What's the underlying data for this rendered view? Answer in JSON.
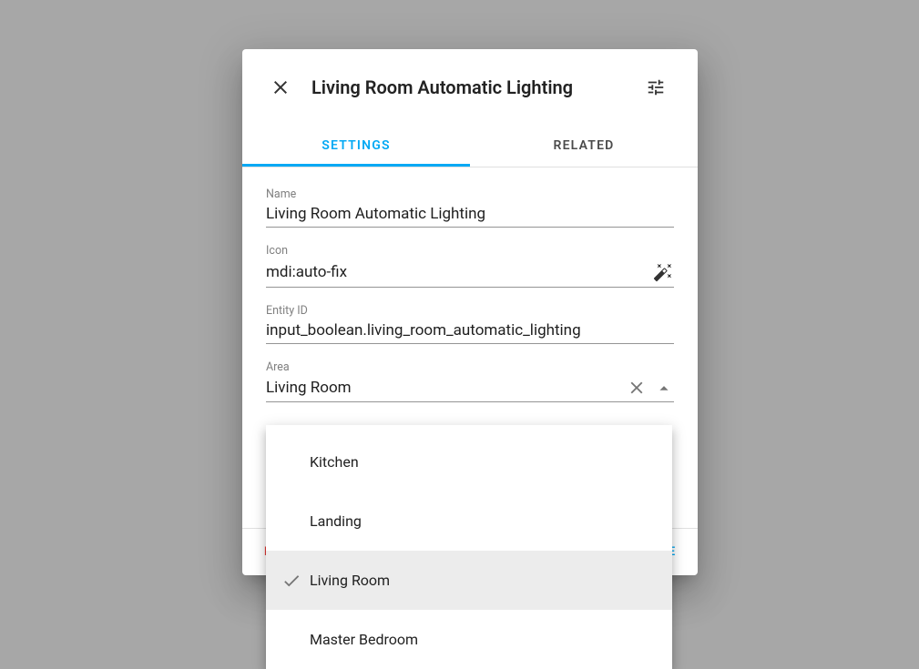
{
  "dialog": {
    "title": "Living Room Automatic Lighting",
    "tabs": {
      "settings": "SETTINGS",
      "related": "RELATED"
    },
    "fields": {
      "name": {
        "label": "Name",
        "value": "Living Room Automatic Lighting"
      },
      "icon": {
        "label": "Icon",
        "value": "mdi:auto-fix"
      },
      "entity_id": {
        "label": "Entity ID",
        "value": "input_boolean.living_room_automatic_lighting"
      },
      "area": {
        "label": "Area",
        "value": "Living Room"
      }
    },
    "area_dropdown": {
      "options": [
        "Kitchen",
        "Landing",
        "Living Room",
        "Master Bedroom"
      ],
      "selected": "Living Room"
    },
    "footer": {
      "delete": "DELETE",
      "update": "UPDATE"
    }
  }
}
